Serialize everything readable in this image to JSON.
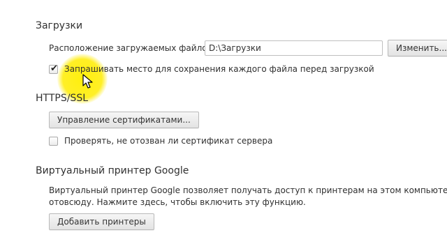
{
  "downloads": {
    "title": "Загрузки",
    "location_label": "Расположение загружаемых файлов:",
    "location_value": "D:\\Загрузки",
    "change_button": "Изменить...",
    "ask_checkbox_label": "Запрашивать место для сохранения каждого файла перед загрузкой",
    "ask_checked": true
  },
  "https_ssl": {
    "title": "HTTPS/SSL",
    "manage_certs_button": "Управление сертификатами...",
    "revocation_checkbox_label": "Проверять, не отозван ли сертификат сервера",
    "revocation_checked": false
  },
  "cloud_print": {
    "title": "Виртуальный принтер Google",
    "description_line1": "Виртуальный принтер Google позволяет получать доступ к принтерам на этом компьютере пра",
    "description_line2": "отовсюду. Нажмите здесь, чтобы включить эту функцию.",
    "add_printers_button": "Добавить принтеры"
  },
  "colors": {
    "highlight": "#ffec00",
    "text": "#303030"
  }
}
